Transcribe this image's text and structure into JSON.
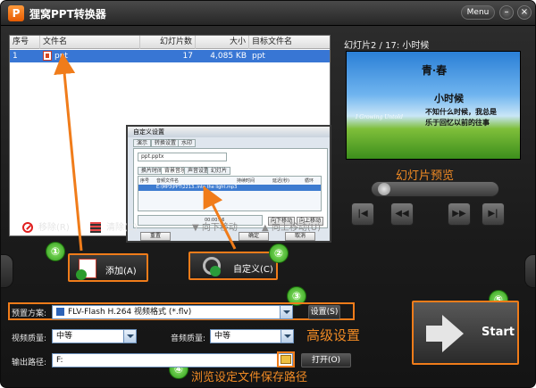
{
  "app": {
    "title": "狸窝PPT转换器",
    "menu_label": "Menu",
    "icon": "ppt-app-icon"
  },
  "file_list": {
    "columns": [
      "序号",
      "文件名",
      "幻灯片数",
      "大小",
      "目标文件名"
    ],
    "rows": [
      {
        "index": "1",
        "filename": "ppt",
        "slides": "17",
        "size": "4,085 KB",
        "target": "ppt"
      }
    ]
  },
  "dialog": {
    "title": "自定义设置",
    "tabs": [
      "演示",
      "转换设置",
      "水印"
    ],
    "file": "ppt.pptx",
    "sub_tabs": [
      "换片时间",
      "背景音乐",
      "声音设置",
      "幻灯片"
    ],
    "music_columns": [
      "序号",
      "音频文件名",
      "持续时间",
      "延迟(秒)",
      "循环"
    ],
    "music_row": "E:\\MP3\\PPT\\2213..into the light.mp3",
    "time": "00:00:16",
    "buttons": [
      "向下移动",
      "向上移动",
      "重置",
      "确定",
      "取消"
    ]
  },
  "list_toolbar": {
    "remove": "移除(R)",
    "clear": "清除(C)",
    "move_down": "向下移动",
    "move_up": "向上移动(U)"
  },
  "actions": {
    "add": "添加(A)",
    "customize": "自定义(C)",
    "start": "Start"
  },
  "badges": [
    "①",
    "②",
    "③",
    "④",
    "⑤"
  ],
  "preview": {
    "header": "幻灯片2 / 17: 小时候",
    "slide_title": "青·春",
    "slide_subtitle": "小时候",
    "slide_line1": "不知什么时候，我总是",
    "slide_line2": "乐于回忆以前的往事",
    "slide_signature": "I Growing Untold",
    "caption": "幻灯片预览"
  },
  "settings": {
    "preset_label": "预置方案:",
    "preset_value": "FLV-Flash H.264 视频格式 (*.flv)",
    "settings_button": "设置(S)",
    "advanced_note": "高级设置",
    "video_quality_label": "视频质量:",
    "video_quality": "中等",
    "audio_quality_label": "音频质量:",
    "audio_quality": "中等",
    "output_label": "输出路径:",
    "output_path": "F:",
    "open_button": "打开(O)",
    "output_note": "浏览设定文件保存路径"
  },
  "colors": {
    "accent_orange": "#f07c1a",
    "selection_blue": "#3876d4",
    "badge_green": "#3aa81e"
  }
}
